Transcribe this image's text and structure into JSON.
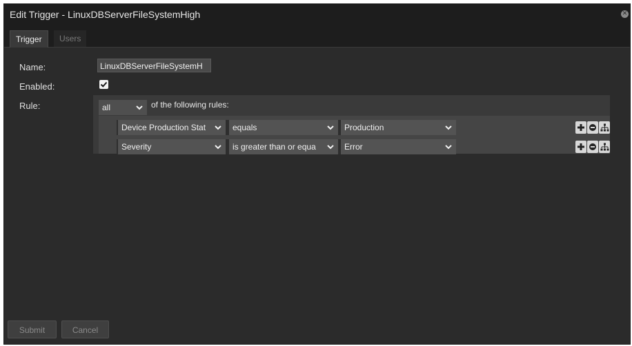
{
  "dialog": {
    "title": "Edit Trigger - LinuxDBServerFileSystemHigh",
    "close_icon": "close-icon"
  },
  "tabs": [
    {
      "label": "Trigger",
      "active": true
    },
    {
      "label": "Users",
      "active": false
    }
  ],
  "form": {
    "name_label": "Name:",
    "name_value": "LinuxDBServerFileSystemH",
    "enabled_label": "Enabled:",
    "enabled_checked": true,
    "rule_label": "Rule:",
    "match_select": "all",
    "match_suffix": "of the following rules:"
  },
  "rules": [
    {
      "field": "Device Production Stat",
      "operator": "equals",
      "value": "Production"
    },
    {
      "field": "Severity",
      "operator": "is greater than or equa",
      "value": "Error"
    }
  ],
  "rule_buttons": [
    "plus-icon",
    "minus-icon",
    "hierarchy-icon"
  ],
  "footer": {
    "submit_label": "Submit",
    "cancel_label": "Cancel"
  },
  "colors": {
    "dialog_bg": "#2b2b2b",
    "titlebar_bg": "#1d1d1d",
    "select_bg": "#535353",
    "text": "#e0e0e0"
  }
}
